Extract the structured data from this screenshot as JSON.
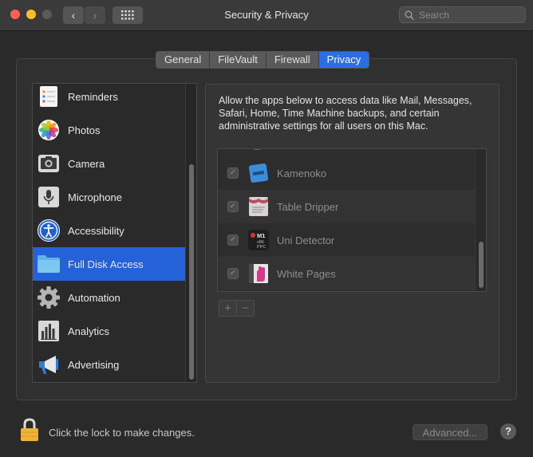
{
  "window": {
    "title": "Security & Privacy"
  },
  "toolbar": {
    "back_glyph": "‹",
    "forward_glyph": "›",
    "search_placeholder": "Search"
  },
  "tabs": [
    {
      "label": "General",
      "active": false
    },
    {
      "label": "FileVault",
      "active": false
    },
    {
      "label": "Firewall",
      "active": false
    },
    {
      "label": "Privacy",
      "active": true
    }
  ],
  "sidebar": {
    "items": [
      {
        "label": "Reminders",
        "icon": "reminders-icon"
      },
      {
        "label": "Photos",
        "icon": "photos-icon"
      },
      {
        "label": "Camera",
        "icon": "camera-icon"
      },
      {
        "label": "Microphone",
        "icon": "microphone-icon"
      },
      {
        "label": "Accessibility",
        "icon": "accessibility-icon"
      },
      {
        "label": "Full Disk Access",
        "icon": "folder-icon",
        "selected": true
      },
      {
        "label": "Automation",
        "icon": "gear-icon"
      },
      {
        "label": "Analytics",
        "icon": "analytics-icon"
      },
      {
        "label": "Advertising",
        "icon": "megaphone-icon"
      }
    ]
  },
  "main": {
    "description": "Allow the apps below to access data like Mail, Messages, Safari, Home, Time Machine backups, and certain administrative settings for all users on this Mac.",
    "apps": [
      {
        "name": "Kamenoko",
        "checked": true,
        "icon": "kamenoko-app-icon"
      },
      {
        "name": "Table Dripper",
        "checked": true,
        "icon": "table-dripper-app-icon"
      },
      {
        "name": "Uni Detector",
        "checked": true,
        "icon": "uni-detector-app-icon",
        "icon_text": [
          "M1",
          "x86",
          "PPC"
        ]
      },
      {
        "name": "White Pages",
        "checked": true,
        "icon": "white-pages-app-icon"
      }
    ],
    "add_label": "+",
    "remove_label": "−"
  },
  "footer": {
    "lock_text": "Click the lock to make changes.",
    "advanced_label": "Advanced...",
    "help_label": "?"
  },
  "colors": {
    "accent": "#2561d9",
    "tab_active": "#2b6ee4",
    "lock": "#f0b23a"
  }
}
